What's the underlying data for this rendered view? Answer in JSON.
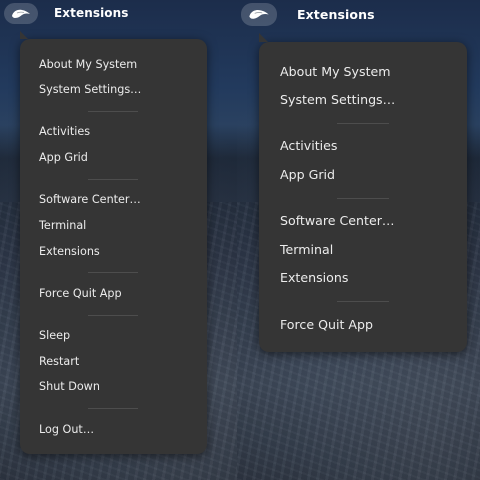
{
  "panels": [
    {
      "id": "left",
      "topbar_title": "Extensions",
      "menu_items": [
        "About My System",
        "System Settings…",
        "Activities",
        "App Grid",
        "Software Center…",
        "Terminal",
        "Extensions",
        "Force Quit App",
        "Sleep",
        "Restart",
        "Shut Down",
        "Log Out…"
      ]
    },
    {
      "id": "right",
      "topbar_title": "Extensions",
      "menu_items": [
        "About My System",
        "System Settings…",
        "Activities",
        "App Grid",
        "Software Center…",
        "Terminal",
        "Extensions",
        "Force Quit App"
      ]
    }
  ],
  "icons": {
    "logo": "distro-logo-icon"
  },
  "colors": {
    "menu_background": "#353535",
    "menu_text": "#ececec",
    "separator": "#4d4d4d",
    "topbar_text": "#ffffff"
  }
}
